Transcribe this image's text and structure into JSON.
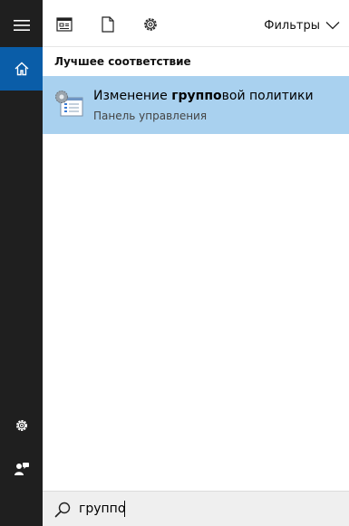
{
  "sidebar": {
    "items": [
      {
        "icon": "hamburger-menu-icon"
      },
      {
        "icon": "home-icon",
        "active": true
      },
      {
        "icon": "settings-gear-icon"
      },
      {
        "icon": "user-feedback-icon"
      }
    ],
    "colors": {
      "background": "#1f1f1f",
      "active": "#0a5da8"
    }
  },
  "topbar": {
    "icons": [
      "apps-icon",
      "documents-icon",
      "web-settings-icon"
    ],
    "filters_label": "Фильтры"
  },
  "results": {
    "section_title": "Лучшее соответствие",
    "best_match": {
      "title_before": "Изменение ",
      "title_highlight": "группо",
      "title_after": "вой политики",
      "subtitle": "Панель управления",
      "icon": "group-policy-icon",
      "highlight_color": "#a9d1ef"
    }
  },
  "search": {
    "value": "группо"
  }
}
